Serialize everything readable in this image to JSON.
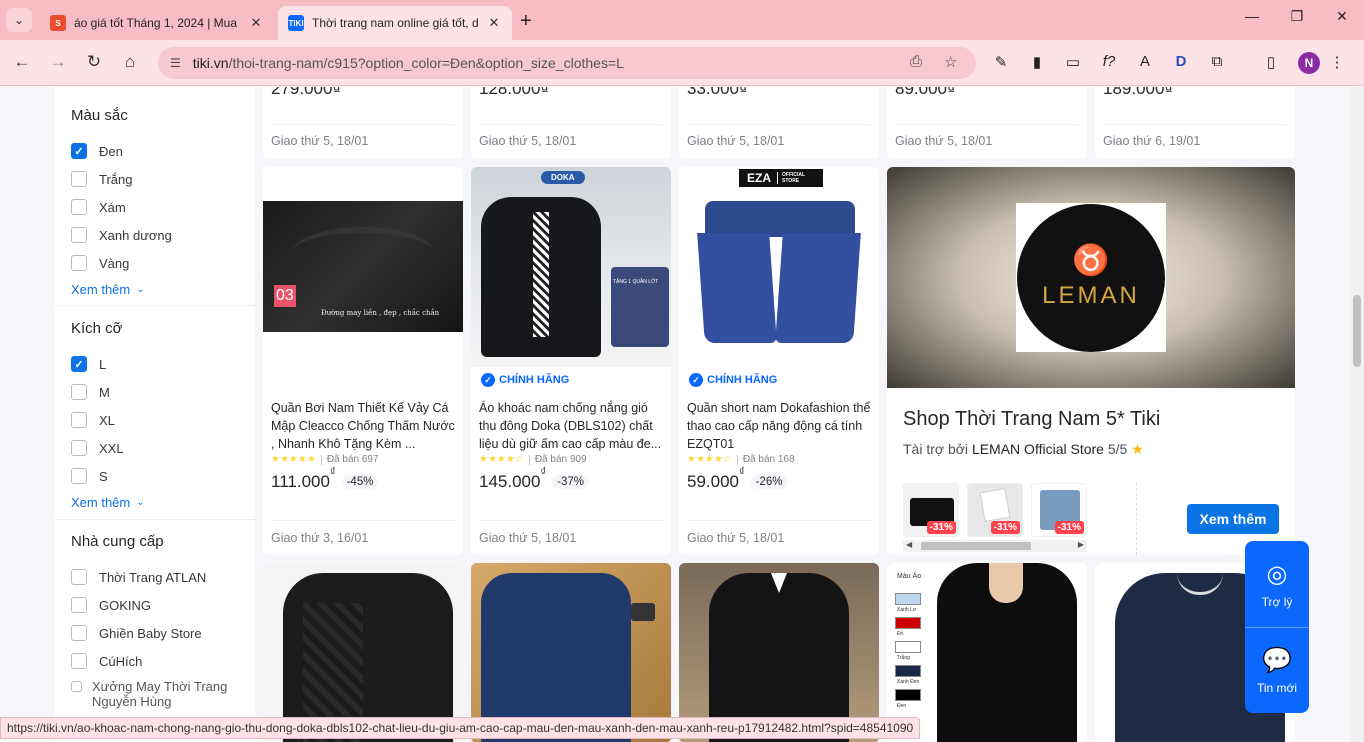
{
  "browser": {
    "tabs": [
      {
        "title": "áo giá tốt Tháng 1, 2024 | Mua",
        "favicon": "shopee-icon",
        "active": false
      },
      {
        "title": "Thời trang nam online giá tốt, d",
        "favicon": "tiki-icon",
        "active": true
      }
    ],
    "url_host": "tiki.vn",
    "url_rest": "/thoi-trang-nam/c915?option_color=Đen&option_size_clothes=L",
    "profile_initial": "N",
    "tiki_fav": "TIKI",
    "new_tab": "+"
  },
  "filters": {
    "color": {
      "title": "Màu sắc",
      "options": [
        {
          "label": "Đen",
          "checked": true
        },
        {
          "label": "Trắng",
          "checked": false
        },
        {
          "label": "Xám",
          "checked": false
        },
        {
          "label": "Xanh dương",
          "checked": false
        },
        {
          "label": "Vàng",
          "checked": false
        }
      ],
      "see_more": "Xem thêm"
    },
    "size": {
      "title": "Kích cỡ",
      "options": [
        {
          "label": "L",
          "checked": true
        },
        {
          "label": "M",
          "checked": false
        },
        {
          "label": "XL",
          "checked": false
        },
        {
          "label": "XXL",
          "checked": false
        },
        {
          "label": "S",
          "checked": false
        }
      ],
      "see_more": "Xem thêm"
    },
    "supplier": {
      "title": "Nhà cung cấp",
      "options": [
        {
          "label": "Thời Trang ATLAN",
          "checked": false
        },
        {
          "label": "GOKING",
          "checked": false
        },
        {
          "label": "Ghiền Baby Store",
          "checked": false
        },
        {
          "label": "CúHích",
          "checked": false
        },
        {
          "label": "Xưởng May Thời Trang Nguyễn Hùng",
          "checked": false
        }
      ]
    }
  },
  "top_row": [
    {
      "price": "279.000₫",
      "ship": "Giao thứ 5, 18/01"
    },
    {
      "price": "128.000₫",
      "ship": "Giao thứ 5, 18/01"
    },
    {
      "price": "33.000₫",
      "ship": "Giao thứ 5, 18/01"
    },
    {
      "price": "89.000₫",
      "ship": "Giao thứ 5, 18/01"
    },
    {
      "price": "189.000₫",
      "ship": "Giao thứ 6, 19/01"
    }
  ],
  "products": [
    {
      "name": "Quần Bơi Nam Thiết Kế Vảy Cá Mập Cleacco Chống Thấm Nước , Nhanh Khô Tặng Kèm ...",
      "badge": "",
      "sold": "Đã bán 697",
      "rating": 5,
      "price": "111.000",
      "currency": "₫",
      "discount": "-45%",
      "ship": "Giao thứ 3, 16/01",
      "img_tag": "03",
      "img_caption": "Đường may liền , đẹp , chắc chắn"
    },
    {
      "name": "Áo khoác nam chống nắng gió thu đông Doka (DBLS102) chất liệu dù giữ ấm cao cấp màu đe...",
      "badge": "CHÍNH HÃNG",
      "sold": "Đã bán 909",
      "rating": 4.5,
      "price": "145.000",
      "currency": "₫",
      "discount": "-37%",
      "ship": "Giao thứ 5, 18/01",
      "img_tag": "DOKA",
      "img_caption": "TẶNG 1 QUẦN LÓT"
    },
    {
      "name": "Quần short nam Dokafashion thể thao cao cấp năng động cá tính EZQT01",
      "badge": "CHÍNH HÃNG",
      "sold": "Đã bán 168",
      "rating": 4.5,
      "price": "59.000",
      "currency": "₫",
      "discount": "-26%",
      "ship": "Giao thứ 5, 18/01",
      "img_tag": "EZA",
      "img_caption": "OFFICIAL STORE"
    }
  ],
  "ad": {
    "logo_text": "LEMAN",
    "title": "Shop Thời Trang Nam 5* Tiki",
    "sponsor_prefix": "Tài trợ bởi ",
    "sponsor_name": "LEMAN Official Store",
    "sponsor_rating": "5/5",
    "thumb_discounts": [
      "-31%",
      "-31%",
      "-31%"
    ],
    "button": "Xem thêm"
  },
  "bottom_row_swatch": {
    "title": "Màu Áo",
    "swatches": [
      "Xanh Lơ",
      "Đỏ",
      "Trắng",
      "Xanh Đen",
      "Đen"
    ]
  },
  "floating": {
    "assistant": "Trợ lý",
    "messages": "Tin mới"
  },
  "status_url": "https://tiki.vn/ao-khoac-nam-chong-nang-gio-thu-dong-doka-dbls102-chat-lieu-du-giu-am-cao-cap-mau-den-mau-xanh-den-mau-xanh-reu-p17912482.html?spid=48541090",
  "colors": {
    "accent": "#0b74e5",
    "tiki_blue": "#0a68ff",
    "discount_red": "#ff424e",
    "star": "#fdd836",
    "chrome_pink": "#f8bcc5"
  }
}
